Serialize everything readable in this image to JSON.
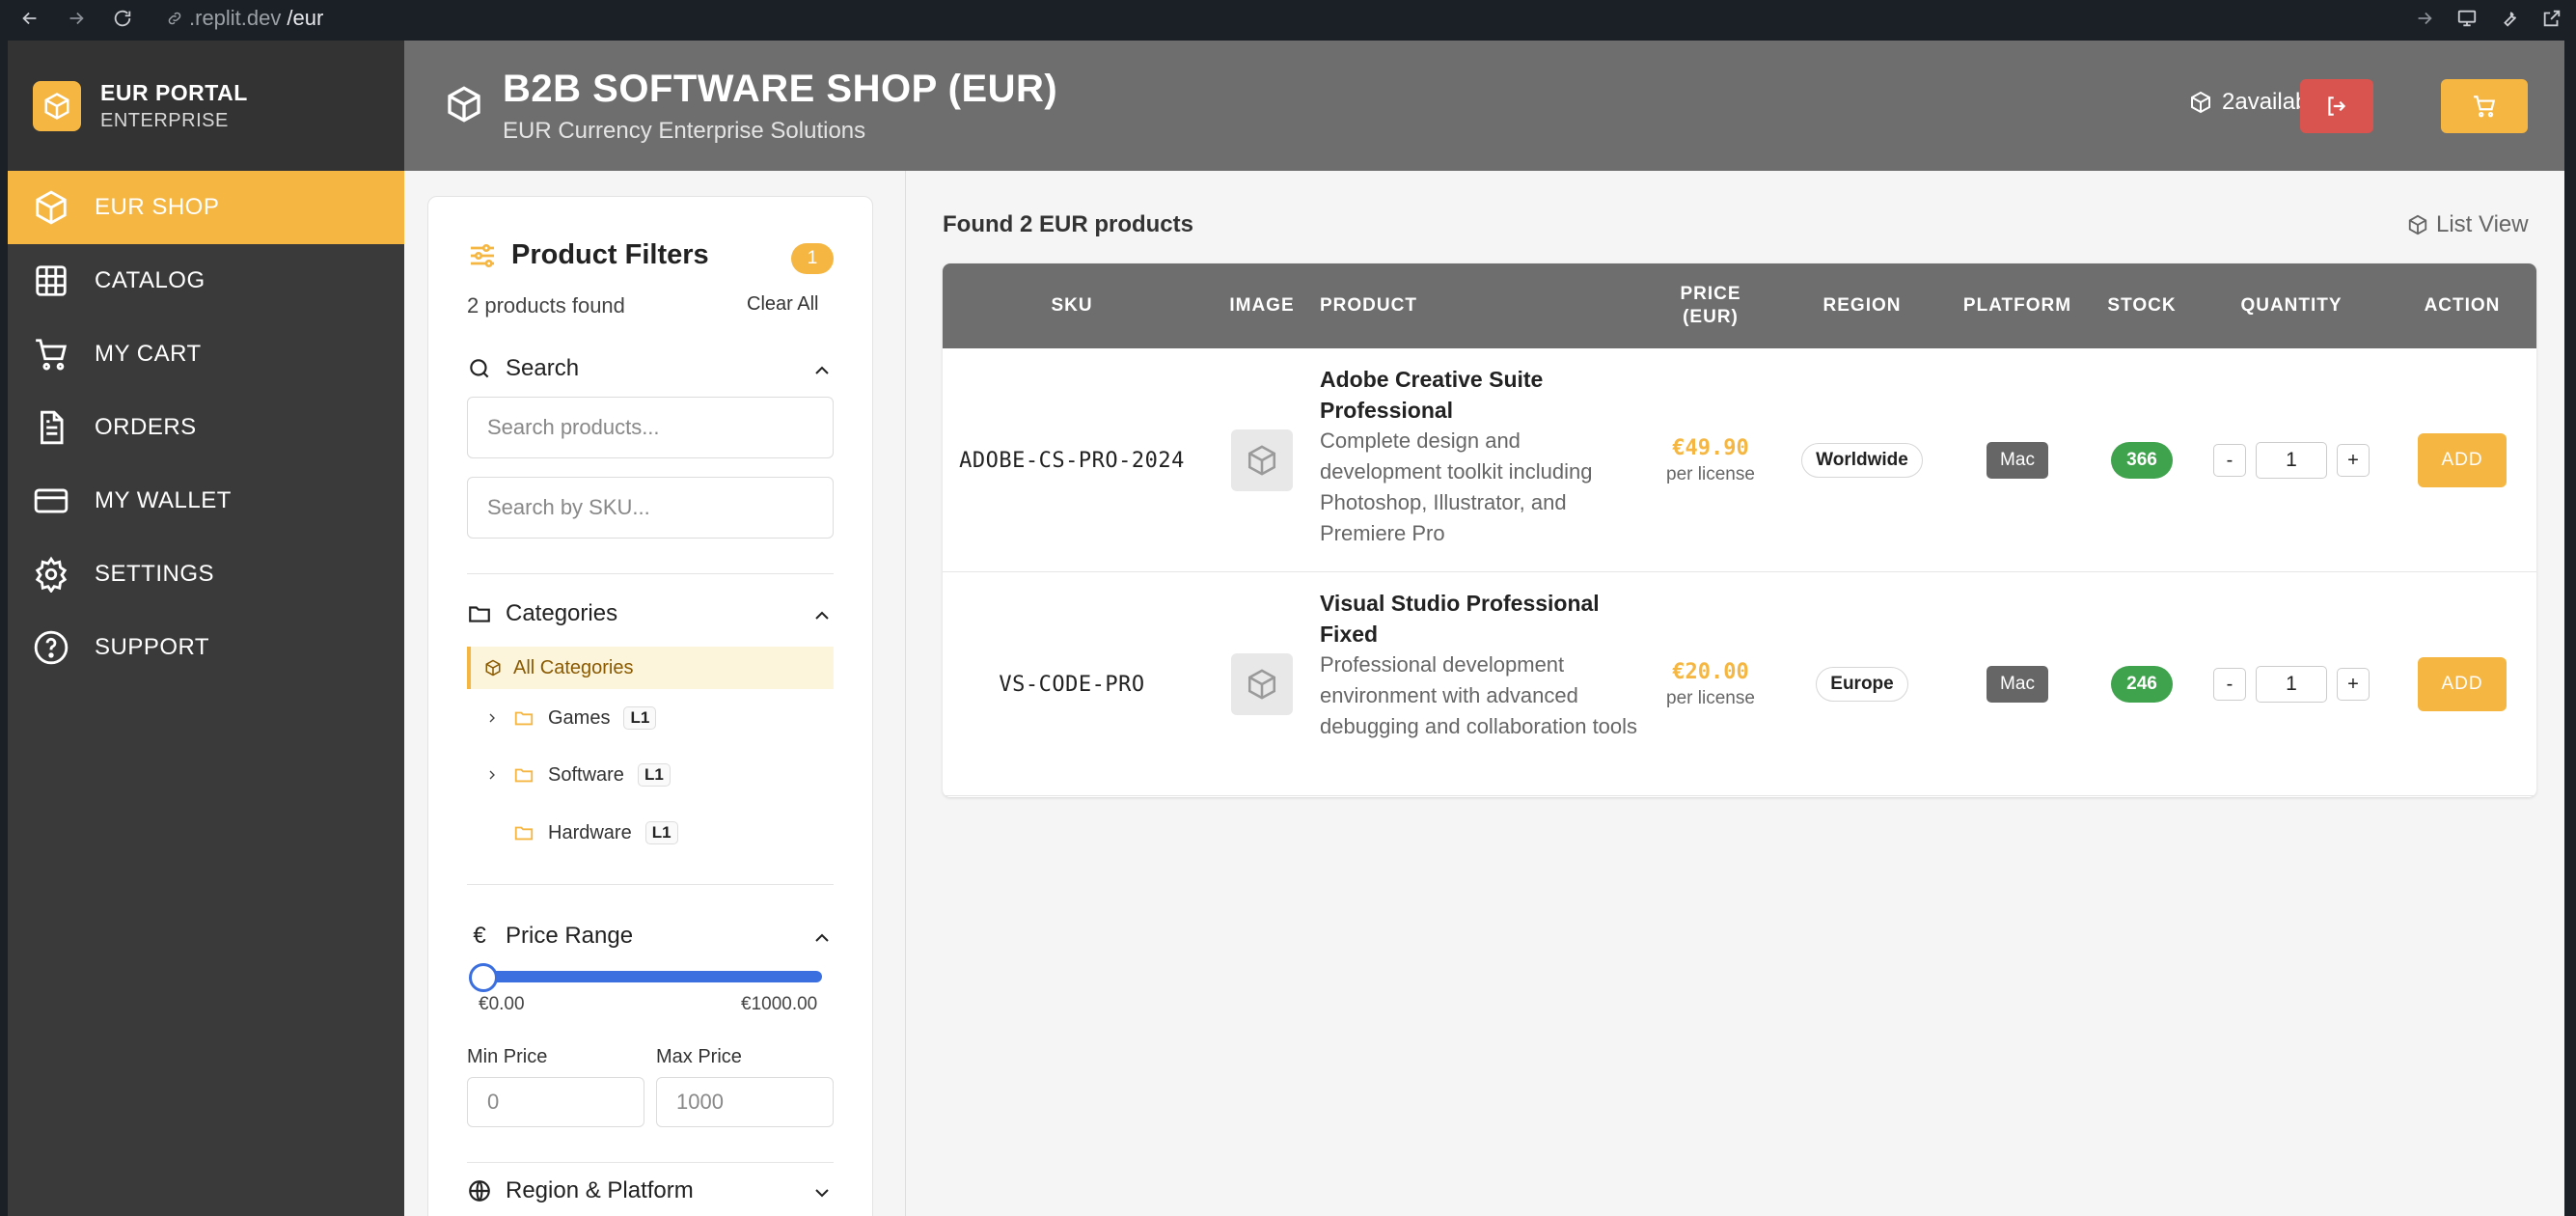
{
  "browser": {
    "url_prefix": ".replit.dev",
    "url_path": "/eur"
  },
  "brand": {
    "title": "EUR PORTAL",
    "subtitle": "ENTERPRISE",
    "logo_icon": "box-icon"
  },
  "sidebar": {
    "items": [
      {
        "label": "EUR SHOP",
        "icon": "box-icon",
        "active": true
      },
      {
        "label": "CATALOG",
        "icon": "grid-icon",
        "active": false
      },
      {
        "label": "MY CART",
        "icon": "cart-icon",
        "active": false
      },
      {
        "label": "ORDERS",
        "icon": "document-icon",
        "active": false
      },
      {
        "label": "MY WALLET",
        "icon": "credit-card-icon",
        "active": false
      },
      {
        "label": "SETTINGS",
        "icon": "gear-icon",
        "active": false
      },
      {
        "label": "SUPPORT",
        "icon": "help-circle-icon",
        "active": false
      }
    ]
  },
  "header": {
    "title": "B2B SOFTWARE SHOP (EUR)",
    "subtitle": "EUR Currency Enterprise Solutions",
    "available": "2available"
  },
  "filters": {
    "title": "Product Filters",
    "badge": "1",
    "found": "2 products found",
    "clear_all": "Clear All",
    "search": {
      "title": "Search",
      "product_placeholder": "Search products...",
      "sku_placeholder": "Search by SKU..."
    },
    "categories": {
      "title": "Categories",
      "all": "All Categories",
      "items": [
        {
          "name": "Games",
          "level": "L1",
          "expandable": true
        },
        {
          "name": "Software",
          "level": "L1",
          "expandable": true
        },
        {
          "name": "Hardware",
          "level": "L1",
          "expandable": false
        }
      ]
    },
    "price_range": {
      "title": "Price Range",
      "min_label": "€0.00",
      "max_label": "€1000.00",
      "slider_min_fraction": 0,
      "slider_max_fraction": 1,
      "min_price_label": "Min Price",
      "max_price_label": "Max Price",
      "min_price_value": "0",
      "max_price_value": "1000"
    },
    "region_platform": {
      "title": "Region & Platform"
    }
  },
  "results": {
    "found_text": "Found 2 EUR products",
    "view_toggle": "List View",
    "columns": [
      "SKU",
      "IMAGE",
      "PRODUCT",
      "PRICE (EUR)",
      "REGION",
      "PLATFORM",
      "STOCK",
      "QUANTITY",
      "ACTION"
    ],
    "rows": [
      {
        "sku": "ADOBE-CS-PRO-2024",
        "name": "Adobe Creative Suite Professional",
        "description": "Complete design and development toolkit including Photoshop, Illustrator, and Premiere Pro",
        "price": "€49.90",
        "price_unit": "per license",
        "region": "Worldwide",
        "platform": "Mac",
        "stock": "366",
        "quantity": "1",
        "action": "ADD"
      },
      {
        "sku": "VS-CODE-PRO",
        "name": "Visual Studio Professional Fixed",
        "description": "Professional development environment with advanced debugging and collaboration tools",
        "price": "€20.00",
        "price_unit": "per license",
        "region": "Europe",
        "platform": "Mac",
        "stock": "246",
        "quantity": "1",
        "action": "ADD"
      }
    ],
    "qty_minus": "-",
    "qty_plus": "+"
  },
  "colors": {
    "accent": "#f5b642",
    "danger": "#d9534f",
    "sidebar": "#3a3a3a",
    "header": "#6e6e6e",
    "stock": "#3fa34d",
    "slider": "#3b6fe0"
  }
}
